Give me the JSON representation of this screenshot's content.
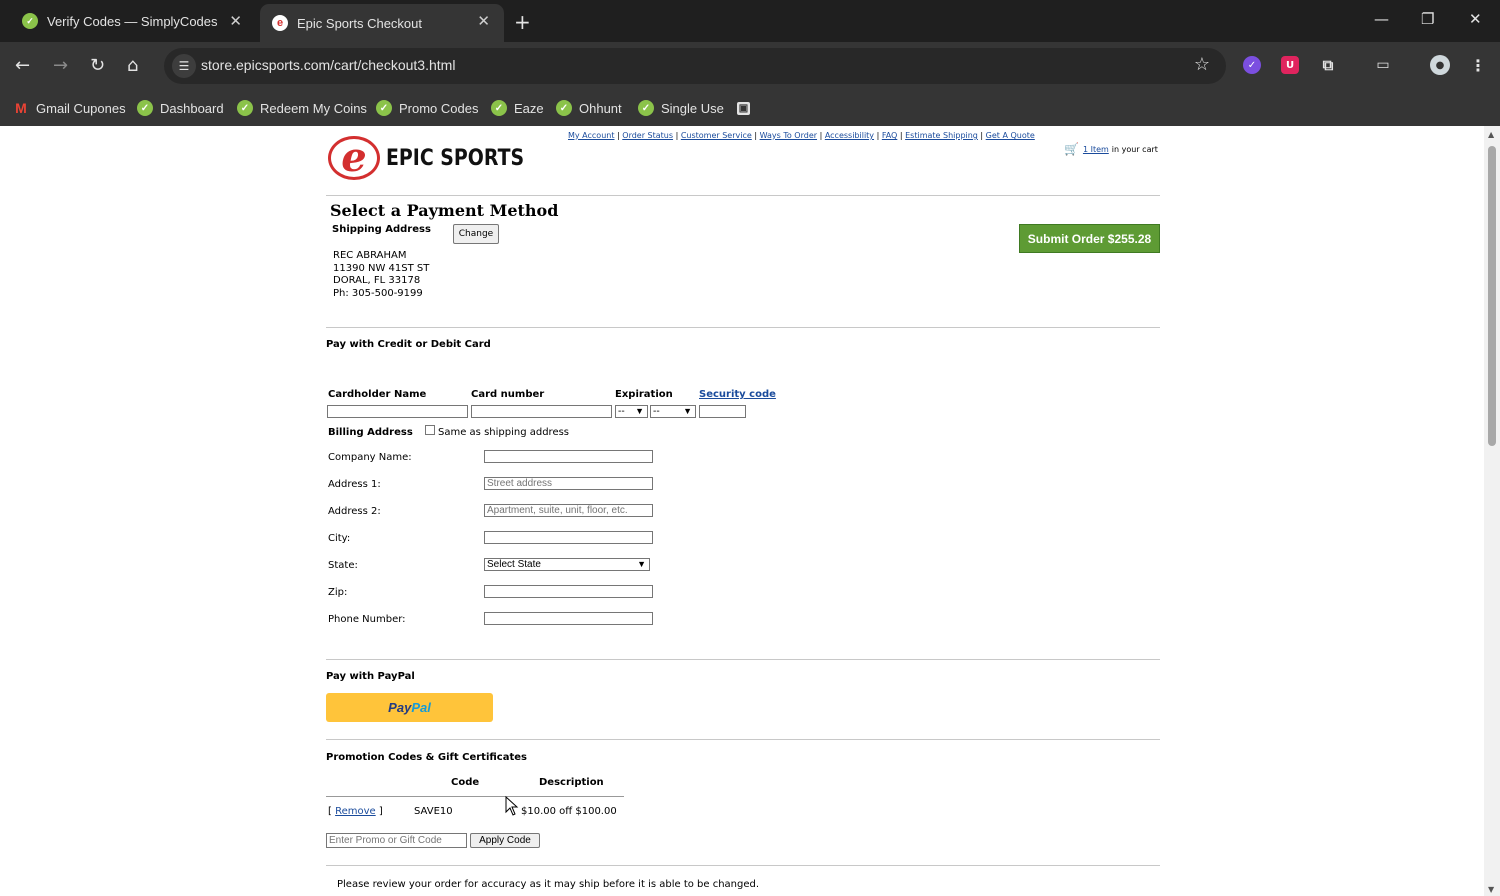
{
  "browser": {
    "tabs": [
      {
        "title": "Verify Codes — SimplyCodes",
        "active": false
      },
      {
        "title": "Epic Sports Checkout",
        "active": true
      }
    ],
    "url": "store.epicsports.com/cart/checkout3.html",
    "bookmarks": [
      "Gmail Cupones",
      "Dashboard",
      "Redeem My Coins",
      "Promo Codes",
      "Eaze",
      "Ohhunt",
      "Single Use"
    ]
  },
  "header": {
    "logo_text": "EPIC SPORTS",
    "links": [
      "My Account",
      "Order Status",
      "Customer Service",
      "Ways To Order",
      "Accessibility",
      "FAQ",
      "Estimate Shipping",
      "Get A Quote"
    ],
    "cart_link": "1 Item",
    "cart_suffix": "in your cart"
  },
  "checkout": {
    "title": "Select a Payment Method",
    "shipping_label": "Shipping Address",
    "change_button": "Change",
    "address_lines": [
      "REC ABRAHAM",
      "11390 NW 41ST ST",
      "DORAL, FL 33178",
      "Ph: 305-500-9199"
    ],
    "submit_button": "Submit Order $255.28"
  },
  "card": {
    "section_title": "Pay with Credit or Debit Card",
    "cardholder_label": "Cardholder Name",
    "number_label": "Card number",
    "expiration_label": "Expiration",
    "security_label": "Security code",
    "exp_month": "--",
    "exp_year": "--",
    "billing_label": "Billing Address",
    "same_as_shipping": "Same as shipping address",
    "fields": [
      {
        "label": "Company Name:",
        "placeholder": ""
      },
      {
        "label": "Address 1:",
        "placeholder": "Street address"
      },
      {
        "label": "Address 2:",
        "placeholder": "Apartment, suite, unit, floor, etc."
      },
      {
        "label": "City:",
        "placeholder": ""
      },
      {
        "label": "State:",
        "placeholder": "Select State"
      },
      {
        "label": "Zip:",
        "placeholder": ""
      },
      {
        "label": "Phone Number:",
        "placeholder": ""
      }
    ]
  },
  "paypal": {
    "section_title": "Pay with PayPal",
    "button_part1": "Pay",
    "button_part2": "Pal"
  },
  "promo": {
    "section_title": "Promotion Codes & Gift Certificates",
    "col_code": "Code",
    "col_description": "Description",
    "rows": [
      {
        "action": "Remove",
        "code": "SAVE10",
        "description": "$10.00 off $100.00"
      }
    ],
    "input_placeholder": "Enter Promo or Gift Code",
    "apply_button": "Apply Code"
  },
  "notice": "Please review your order for accuracy as it may ship before it is able to be changed."
}
